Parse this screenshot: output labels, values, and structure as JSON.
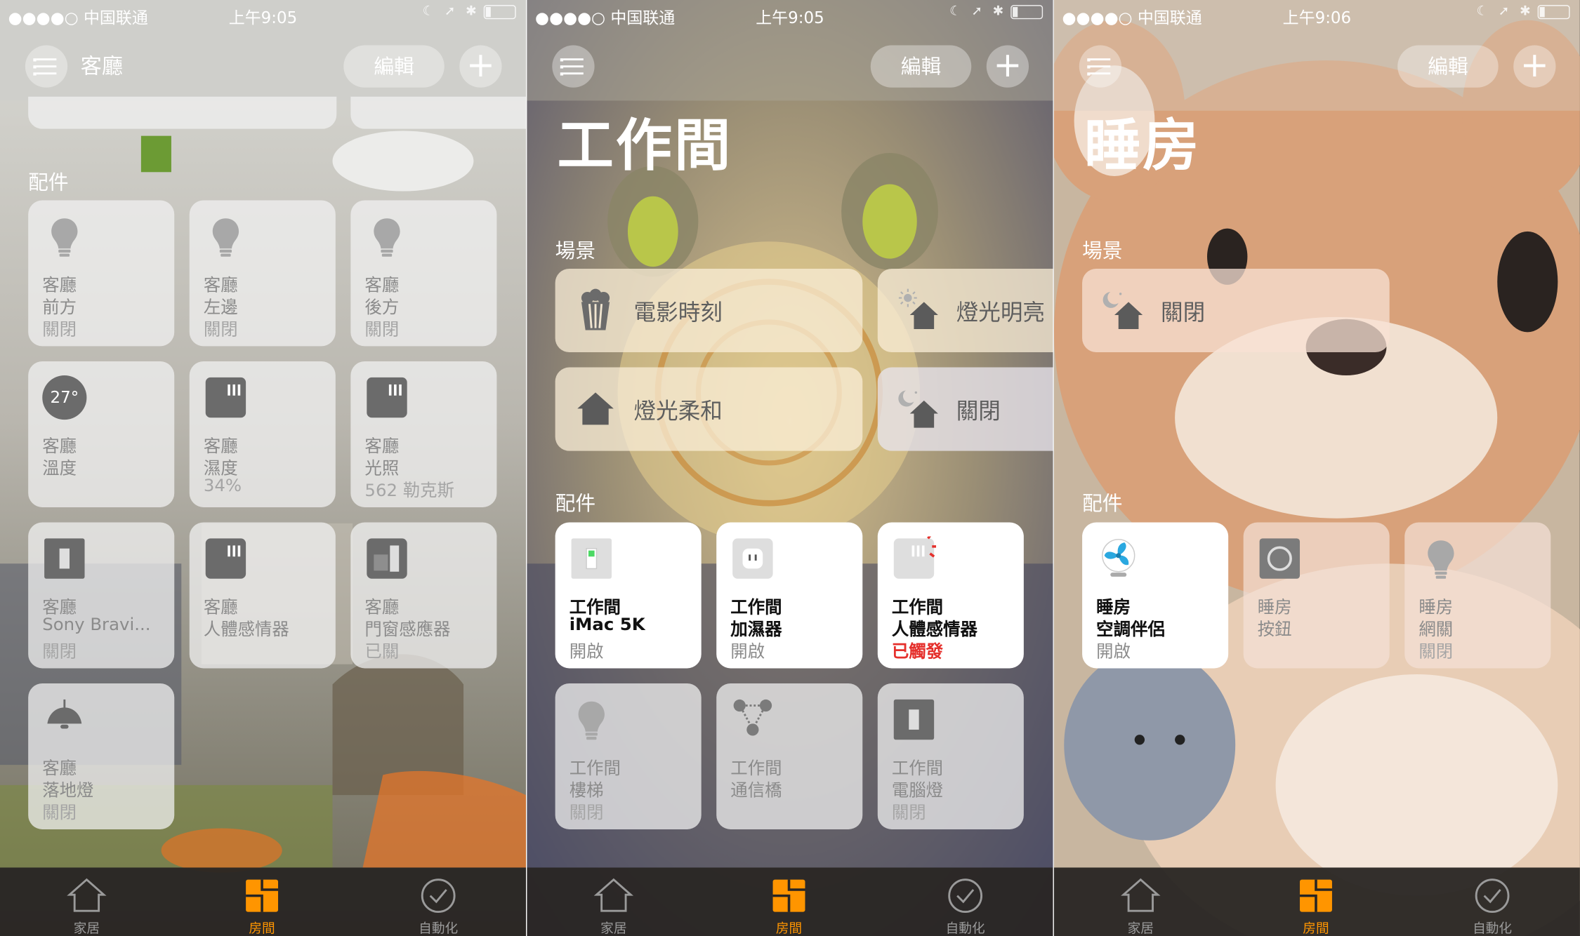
{
  "status_bar": {
    "carrier": "●●●●○ 中国联通",
    "panels": [
      {
        "time": "上午9:05"
      },
      {
        "time": "上午9:05"
      },
      {
        "time": "上午9:06"
      }
    ]
  },
  "toolbar": {
    "edit_label": "編輯",
    "add_label": "+"
  },
  "tabbar": {
    "home": "家居",
    "rooms": "房間",
    "automation": "自動化"
  },
  "panels": [
    {
      "room_name": "客廳",
      "accessories_header": "配件",
      "accessories": [
        {
          "line1": "客廳",
          "line2": "前方",
          "status": "關閉",
          "icon": "bulb-icon"
        },
        {
          "line1": "客廳",
          "line2": "左邊",
          "status": "關閉",
          "icon": "bulb-icon"
        },
        {
          "line1": "客廳",
          "line2": "後方",
          "status": "關閉",
          "icon": "bulb-icon"
        },
        {
          "line1": "客廳",
          "line2": "溫度",
          "status": "",
          "icon": "thermometer-icon",
          "badge": "27°"
        },
        {
          "line1": "客廳",
          "line2": "濕度",
          "status": "34%",
          "icon": "sensor-icon"
        },
        {
          "line1": "客廳",
          "line2": "光照",
          "status": "562 勒克斯",
          "icon": "sensor-icon"
        },
        {
          "line1": "客廳",
          "line2": "Sony Bravi...",
          "status": "關閉",
          "icon": "switch-icon"
        },
        {
          "line1": "客廳",
          "line2": "人體感情器",
          "status": "",
          "icon": "sensor-icon"
        },
        {
          "line1": "客廳",
          "line2": "門窗感應器",
          "status": "已關",
          "icon": "door-sensor-icon"
        },
        {
          "line1": "客廳",
          "line2": "落地燈",
          "status": "關閉",
          "icon": "floor-lamp-icon"
        }
      ]
    },
    {
      "room_name": "工作間",
      "scenes_header": "場景",
      "scenes": [
        {
          "label": "電影時刻",
          "icon": "popcorn-icon"
        },
        {
          "label": "燈光明亮",
          "icon": "sun-house-icon"
        },
        {
          "label": "燈光柔和",
          "icon": "house-icon"
        },
        {
          "label": "關閉",
          "icon": "moon-house-icon"
        }
      ],
      "accessories_header": "配件",
      "accessories": [
        {
          "line1": "工作間",
          "line2": "iMac 5K",
          "status": "開啟",
          "icon": "switch-on-icon",
          "on": true
        },
        {
          "line1": "工作間",
          "line2": "加濕器",
          "status": "開啟",
          "icon": "outlet-icon",
          "on": true
        },
        {
          "line1": "工作間",
          "line2": "人體感情器",
          "status": "已觸發",
          "icon": "motion-sensor-icon",
          "on": true,
          "alert": true
        },
        {
          "line1": "工作間",
          "line2": "樓梯",
          "status": "關閉",
          "icon": "bulb-icon"
        },
        {
          "line1": "工作間",
          "line2": "通信橋",
          "status": "",
          "icon": "bridge-icon"
        },
        {
          "line1": "工作間",
          "line2": "電腦燈",
          "status": "關閉",
          "icon": "switch-icon"
        }
      ]
    },
    {
      "room_name": "睡房",
      "scenes_header": "場景",
      "scenes": [
        {
          "label": "關閉",
          "icon": "moon-house-icon"
        }
      ],
      "accessories_header": "配件",
      "accessories": [
        {
          "line1": "睡房",
          "line2": "空調伴侶",
          "status": "開啟",
          "icon": "fan-icon",
          "on": true
        },
        {
          "line1": "睡房",
          "line2": "按鈕",
          "status": "",
          "icon": "button-icon"
        },
        {
          "line1": "睡房",
          "line2": "網關",
          "status": "關閉",
          "icon": "bulb-icon"
        }
      ]
    }
  ],
  "colors": {
    "accent": "#ff9500",
    "alert": "#e5302c",
    "tabbar": "#282523"
  }
}
